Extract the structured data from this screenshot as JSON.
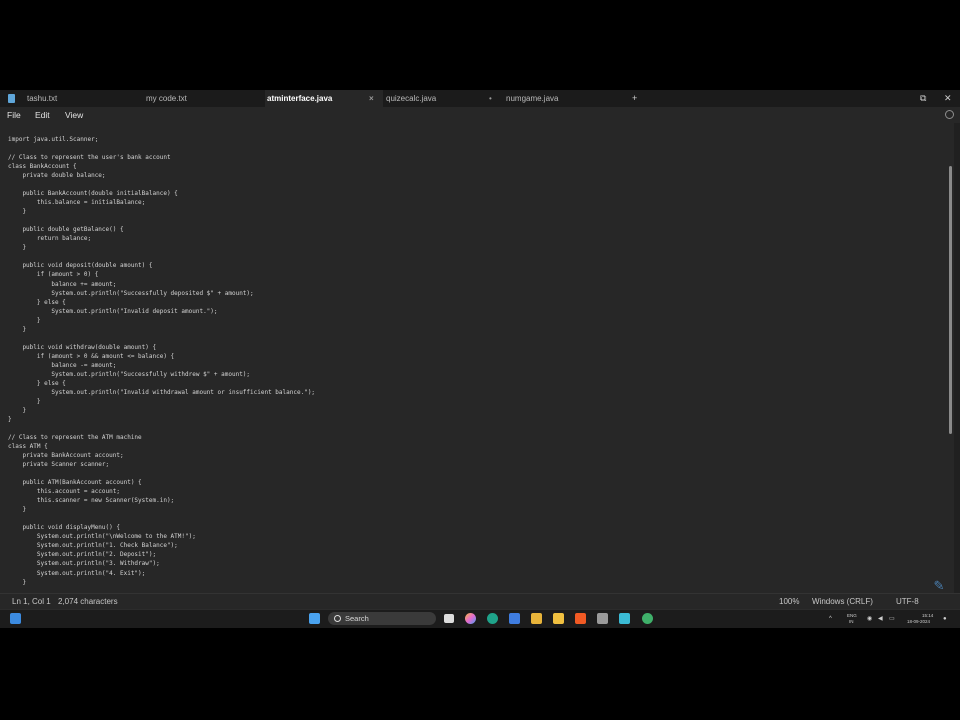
{
  "tabs": [
    {
      "label": "tashu.txt",
      "active": false
    },
    {
      "label": "my code.txt",
      "active": false
    },
    {
      "label": "atminterface.java",
      "active": true
    },
    {
      "label": "quizecalc.java",
      "active": false
    },
    {
      "label": "numgame.java",
      "active": false
    }
  ],
  "tab_close_glyph": "×",
  "tab_dot_glyph": "•",
  "new_tab_glyph": "+",
  "window_controls": {
    "restore": "⧉",
    "close": "✕"
  },
  "menu": {
    "file": "File",
    "edit": "Edit",
    "view": "View"
  },
  "code_lines": [
    "import java.util.Scanner;",
    "",
    "// Class to represent the user's bank account",
    "class BankAccount {",
    "    private double balance;",
    "",
    "    public BankAccount(double initialBalance) {",
    "        this.balance = initialBalance;",
    "    }",
    "",
    "    public double getBalance() {",
    "        return balance;",
    "    }",
    "",
    "    public void deposit(double amount) {",
    "        if (amount > 0) {",
    "            balance += amount;",
    "            System.out.println(\"Successfully deposited $\" + amount);",
    "        } else {",
    "            System.out.println(\"Invalid deposit amount.\");",
    "        }",
    "    }",
    "",
    "    public void withdraw(double amount) {",
    "        if (amount > 0 && amount <= balance) {",
    "            balance -= amount;",
    "            System.out.println(\"Successfully withdrew $\" + amount);",
    "        } else {",
    "            System.out.println(\"Invalid withdrawal amount or insufficient balance.\");",
    "        }",
    "    }",
    "}",
    "",
    "// Class to represent the ATM machine",
    "class ATM {",
    "    private BankAccount account;",
    "    private Scanner scanner;",
    "",
    "    public ATM(BankAccount account) {",
    "        this.account = account;",
    "        this.scanner = new Scanner(System.in);",
    "    }",
    "",
    "    public void displayMenu() {",
    "        System.out.println(\"\\nWelcome to the ATM!\");",
    "        System.out.println(\"1. Check Balance\");",
    "        System.out.println(\"2. Deposit\");",
    "        System.out.println(\"3. Withdraw\");",
    "        System.out.println(\"4. Exit\");",
    "    }"
  ],
  "status": {
    "position": "Ln 1, Col 1",
    "characters": "2,074 characters",
    "zoom": "100%",
    "line_ending": "Windows (CRLF)",
    "encoding": "UTF-8"
  },
  "taskbar": {
    "search_placeholder": "Search",
    "tray_chevron": "^",
    "language": "ENG",
    "region": "IN",
    "time": "15:14",
    "date": "18-09-2024"
  },
  "colors": {
    "accent": "#3c8be0",
    "editor_bg": "#272727",
    "tab_bar_bg": "#1b1b1b"
  },
  "icons": [
    "notepad-app-icon",
    "gear-icon",
    "windows-start-icon",
    "search-icon",
    "task-view-icon",
    "copilot-icon",
    "edge-icon",
    "store-icon",
    "file-explorer-icon",
    "brave-icon",
    "chatgpt-icon",
    "notepad-icon",
    "wifi-icon",
    "volume-icon",
    "battery-icon",
    "notification-icon"
  ]
}
